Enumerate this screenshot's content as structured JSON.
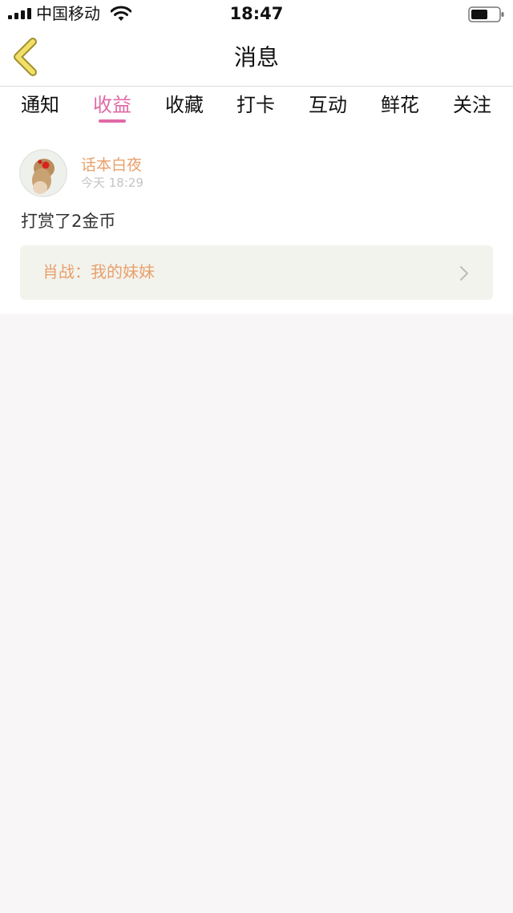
{
  "status_bar": {
    "carrier": "中国移动",
    "time": "18:47",
    "icons": [
      "signal-icon",
      "wifi-icon",
      "battery-icon"
    ]
  },
  "nav": {
    "title": "消息",
    "back_icon": "chevron-left-icon"
  },
  "tabs": [
    {
      "label": "通知",
      "active": false
    },
    {
      "label": "收益",
      "active": true
    },
    {
      "label": "收藏",
      "active": false
    },
    {
      "label": "打卡",
      "active": false
    },
    {
      "label": "互动",
      "active": false
    },
    {
      "label": "鲜花",
      "active": false
    },
    {
      "label": "关注",
      "active": false
    }
  ],
  "message": {
    "username": "话本白夜",
    "time": "今天 18:29",
    "text": "打赏了2金币",
    "link_label": "肖战：我的妹妹"
  },
  "colors": {
    "accent_pink": "#e06aa6",
    "name_orange": "#e8a06b",
    "back_arrow_yellow": "#f2df6a",
    "page_bg": "#f8f6f6",
    "card_bg": "#f3f3ee"
  }
}
